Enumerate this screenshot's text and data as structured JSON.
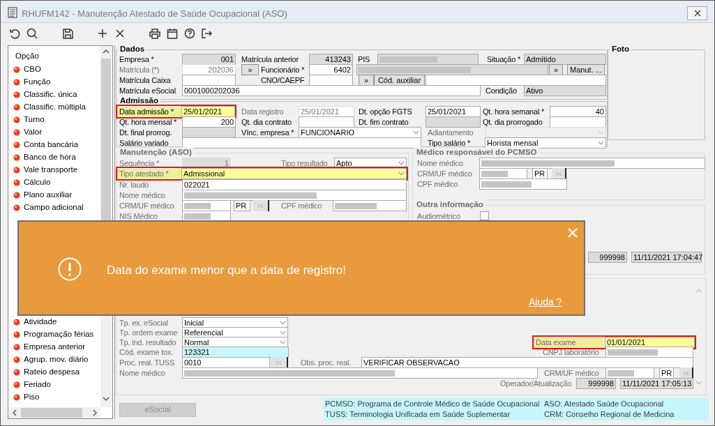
{
  "window": {
    "title": "RHUFM142 - Manutenção Atestado de Saúde Ocupacional (ASO)"
  },
  "sidebar": {
    "header": "Opção",
    "items": [
      {
        "label": "CBO"
      },
      {
        "label": "Função"
      },
      {
        "label": "Classific. única"
      },
      {
        "label": "Classific. múltipla"
      },
      {
        "label": "Turno"
      },
      {
        "label": "Valor"
      },
      {
        "label": "Conta bancária"
      },
      {
        "label": "Banco de hora"
      },
      {
        "label": "Vale transporte"
      },
      {
        "label": "Cálculo"
      },
      {
        "label": "Plano auxiliar"
      },
      {
        "label": "Campo adicional"
      }
    ],
    "items_below": [
      {
        "label": "Atividade"
      },
      {
        "label": "Programação férias"
      },
      {
        "label": "Empresa anterior"
      },
      {
        "label": "Agrup. mov. diário"
      },
      {
        "label": "Rateio despesa"
      },
      {
        "label": "Feriado"
      },
      {
        "label": "Piso"
      }
    ]
  },
  "sections": [
    {
      "title": "Dados",
      "disabled": false,
      "rows": [
        {
          "items": [
            {
              "kind": "label",
              "text": "Empresa *",
              "disabled": false
            },
            {
              "kind": "readonly",
              "value": "001",
              "masked": false,
              "disabled": false
            },
            {
              "kind": "label",
              "text": "Matrícula anterior",
              "disabled": false
            },
            {
              "kind": "readonly",
              "value": "413243",
              "masked": false,
              "disabled": false
            },
            {
              "kind": "label",
              "text": "PIS",
              "disabled": false
            },
            {
              "kind": "readonly",
              "masked": true,
              "disabled": false
            },
            {
              "kind": "label",
              "text": "Situação *",
              "disabled": false
            },
            {
              "kind": "readonly",
              "value": "Admitido",
              "masked": false,
              "disabled": false
            }
          ]
        },
        {
          "items": [
            {
              "kind": "label",
              "text": "Matrícula (*)",
              "disabled": true
            },
            {
              "kind": "field",
              "value": "202036",
              "masked": false,
              "disabled": true
            },
            {
              "kind": "button",
              "text": "»"
            },
            {
              "kind": "label",
              "text": "Funcionário *",
              "disabled": false
            },
            {
              "kind": "field",
              "value": "6402",
              "masked": false,
              "disabled": false
            },
            {
              "kind": "readonly",
              "masked": true,
              "disabled": false
            },
            {
              "kind": "button",
              "text": "»"
            },
            {
              "kind": "button",
              "text": "Manut. ..."
            }
          ]
        },
        {
          "items": [
            {
              "kind": "label",
              "text": "Matrícula Caixa",
              "disabled": false
            },
            {
              "kind": "field",
              "masked": false,
              "disabled": false
            },
            {
              "kind": "label",
              "text": "CNO/CAEPF",
              "disabled": false
            },
            {
              "kind": "field",
              "masked": false,
              "disabled": false
            },
            {
              "kind": "button",
              "text": "»"
            },
            {
              "kind": "button",
              "text": "Cód. auxiliar"
            },
            {
              "kind": "field",
              "masked": false,
              "disabled": false
            }
          ]
        },
        {
          "items": [
            {
              "kind": "label",
              "text": "Matrícula eSocial",
              "disabled": false
            },
            {
              "kind": "field",
              "value": "0001000202036",
              "masked": false,
              "disabled": false
            },
            {
              "kind": "label",
              "text": "Condição",
              "disabled": false
            },
            {
              "kind": "readonly",
              "value": "Ativo",
              "masked": false,
              "disabled": false
            }
          ]
        }
      ]
    },
    {
      "title": "Foto",
      "disabled": false
    },
    {
      "title": "Admissão",
      "disabled": false,
      "rows": [
        {
          "items": [
            {
              "kind": "alert",
              "items": [
                {
                  "kind": "label",
                  "text": "Data admissão *",
                  "disabled": false
                },
                {
                  "kind": "field",
                  "value": "25/01/2021",
                  "masked": false,
                  "disabled": false
                }
              ]
            },
            {
              "kind": "label",
              "text": "Data registro",
              "disabled": true
            },
            {
              "kind": "field",
              "value": "25/01/2021",
              "masked": false,
              "disabled": true
            },
            {
              "kind": "label",
              "text": "Dt. opção FGTS",
              "disabled": false
            },
            {
              "kind": "field",
              "value": "25/01/2021",
              "masked": false,
              "disabled": false
            },
            {
              "kind": "label",
              "text": "Qt. hora semanal *",
              "disabled": false
            },
            {
              "kind": "field",
              "value": "40",
              "masked": false,
              "disabled": false
            }
          ]
        },
        {
          "items": [
            {
              "kind": "label",
              "text": "Qt. hora mensal *",
              "disabled": false
            },
            {
              "kind": "field",
              "value": "200",
              "masked": false,
              "disabled": false
            },
            {
              "kind": "label",
              "text": "Qt. dia contrato",
              "disabled": false
            },
            {
              "kind": "field",
              "masked": false,
              "disabled": false
            },
            {
              "kind": "label",
              "text": "Dt. fim contrato",
              "disabled": false
            },
            {
              "kind": "readonly",
              "masked": false,
              "disabled": false
            },
            {
              "kind": "label",
              "text": "Qt. dia prorrogado",
              "disabled": false
            },
            {
              "kind": "field",
              "masked": false,
              "disabled": false
            }
          ]
        },
        {
          "items": [
            {
              "kind": "label",
              "text": "Dt. final prorrog.",
              "disabled": false
            },
            {
              "kind": "readonly",
              "masked": false,
              "disabled": false
            },
            {
              "kind": "label",
              "text": "Vínc. empresa *",
              "disabled": false
            },
            {
              "kind": "select",
              "value": "FUNCIONARIO",
              "masked": false,
              "disabled": false
            },
            {
              "kind": "label",
              "text": "Adiantamento",
              "disabled": true
            },
            {
              "kind": "select",
              "masked": false,
              "disabled": true
            }
          ]
        },
        {
          "items": [
            {
              "kind": "label",
              "text": "Salário variado",
              "disabled": false
            },
            {
              "kind": "field",
              "masked": false,
              "disabled": false
            },
            {
              "kind": "label",
              "text": "Tipo salário *",
              "disabled": false
            },
            {
              "kind": "select",
              "value": "Horista mensal",
              "masked": false,
              "disabled": false
            }
          ]
        }
      ]
    },
    {
      "title": "Manutenção (ASO)",
      "disabled": true,
      "rows": [
        {
          "items": [
            {
              "kind": "label",
              "text": "Sequência *",
              "disabled": true
            },
            {
              "kind": "readonly",
              "value": "1",
              "masked": false,
              "disabled": true
            },
            {
              "kind": "label",
              "text": "Tipo resultado",
              "disabled": true
            },
            {
              "kind": "select",
              "value": "Apto",
              "masked": false,
              "disabled": false
            }
          ]
        },
        {
          "items": [
            {
              "kind": "alert",
              "items": [
                {
                  "kind": "label",
                  "text": "Tipo atestado *",
                  "disabled": true
                },
                {
                  "kind": "select",
                  "value": "Admissional",
                  "masked": false,
                  "disabled": false
                }
              ]
            }
          ]
        },
        {
          "items": [
            {
              "kind": "label",
              "text": "Nr. laudo",
              "disabled": true
            },
            {
              "kind": "field",
              "value": "022021",
              "masked": false,
              "disabled": false
            }
          ]
        },
        {
          "items": [
            {
              "kind": "label",
              "text": "Nome médico",
              "disabled": true
            },
            {
              "kind": "field",
              "masked": true,
              "disabled": false
            }
          ]
        },
        {
          "items": [
            {
              "kind": "label",
              "text": "CRM/UF médico",
              "disabled": true
            },
            {
              "kind": "field",
              "masked": true,
              "disabled": false
            },
            {
              "kind": "field",
              "value": "PR",
              "masked": false,
              "disabled": false
            },
            {
              "kind": "iconbutton"
            },
            {
              "kind": "label",
              "text": "CPF médico",
              "disabled": true
            },
            {
              "kind": "field",
              "masked": true,
              "disabled": false
            }
          ]
        },
        {
          "items": [
            {
              "kind": "label",
              "text": "NIS Médico",
              "disabled": true
            },
            {
              "kind": "field",
              "masked": true,
              "disabled": false
            }
          ]
        }
      ]
    },
    {
      "title": "Médico responsável do PCMSO",
      "disabled": true,
      "rows": [
        {
          "items": [
            {
              "kind": "label",
              "text": "Nome médico",
              "disabled": true
            },
            {
              "kind": "field",
              "masked": true,
              "disabled": false
            }
          ]
        },
        {
          "items": [
            {
              "kind": "label",
              "text": "CRM/UF médico",
              "disabled": true
            },
            {
              "kind": "field",
              "masked": true,
              "disabled": false
            },
            {
              "kind": "field",
              "value": "PR",
              "masked": false,
              "disabled": false
            },
            {
              "kind": "iconbutton"
            }
          ]
        },
        {
          "items": [
            {
              "kind": "label",
              "text": "CPF médico",
              "disabled": true
            },
            {
              "kind": "field",
              "masked": true,
              "disabled": false
            }
          ]
        }
      ]
    },
    {
      "title": "Outra informação",
      "disabled": true,
      "rows": [
        {
          "items": [
            {
              "kind": "label",
              "text": "Audiométrico",
              "disabled": true
            },
            {
              "kind": "check",
              "checked": false
            }
          ]
        },
        {
          "items": [
            {
              "kind": "readonly",
              "value": "999998",
              "masked": false,
              "disabled": false
            },
            {
              "kind": "readonly",
              "value": "11/11/2021 17:04:47",
              "masked": false,
              "disabled": false
            }
          ]
        }
      ]
    },
    {
      "disabled": true,
      "rows": [
        {
          "items": [
            {
              "kind": "label",
              "text": "Tp. ex. eSocial",
              "disabled": true
            },
            {
              "kind": "select",
              "value": "Inicial",
              "masked": false,
              "disabled": false
            }
          ]
        },
        {
          "items": [
            {
              "kind": "label",
              "text": "Tp. ordem exame",
              "disabled": true
            },
            {
              "kind": "select",
              "value": "Referencial",
              "masked": false,
              "disabled": false
            }
          ]
        },
        {
          "items": [
            {
              "kind": "label",
              "text": "Tp. ind. resultado",
              "disabled": true
            },
            {
              "kind": "select",
              "value": "Normal",
              "masked": false,
              "disabled": false
            },
            {
              "kind": "alert",
              "items": [
                {
                  "kind": "label",
                  "text": "Data exame",
                  "disabled": true
                },
                {
                  "kind": "field",
                  "value": "01/01/2021",
                  "masked": false,
                  "disabled": false
                }
              ]
            }
          ]
        },
        {
          "items": [
            {
              "kind": "label",
              "text": "Cód. exame tox.",
              "disabled": true
            },
            {
              "kind": "active",
              "value": "123321",
              "masked": false,
              "disabled": false
            },
            {
              "kind": "label",
              "text": "CNPJ laboratório",
              "disabled": true
            },
            {
              "kind": "field",
              "masked": true,
              "disabled": false
            }
          ]
        },
        {
          "items": [
            {
              "kind": "label",
              "text": "Proc. real. TUSS",
              "disabled": true
            },
            {
              "kind": "field",
              "value": "0010",
              "masked": false,
              "disabled": false
            },
            {
              "kind": "iconbutton"
            },
            {
              "kind": "label",
              "text": "Obs. proc. real.",
              "disabled": true
            },
            {
              "kind": "field",
              "value": "VERIFICAR OBSERVACAO",
              "masked": false,
              "disabled": false
            }
          ]
        },
        {
          "items": [
            {
              "kind": "label",
              "text": "Nome médico",
              "disabled": true
            },
            {
              "kind": "field",
              "masked": true,
              "disabled": false
            },
            {
              "kind": "label",
              "text": "CRM/UF médico",
              "disabled": true
            },
            {
              "kind": "field",
              "masked": true,
              "disabled": false
            },
            {
              "kind": "field",
              "value": "PR",
              "masked": false,
              "disabled": false
            },
            {
              "kind": "iconbutton"
            }
          ]
        },
        {
          "items": [
            {
              "kind": "label",
              "text": "Operador/Atualização",
              "disabled": true
            },
            {
              "kind": "readonly",
              "value": "999998",
              "masked": false,
              "disabled": false
            },
            {
              "kind": "readonly",
              "value": "11/11/2021 17:05:13",
              "masked": false,
              "disabled": false
            }
          ]
        }
      ]
    }
  ],
  "esocial_button": {
    "text": "eSocial",
    "disabled": true
  },
  "legend": [
    "PCMSO: Programa de Controle Médico de Saúde Ocupacional",
    "ASO: Atestado Saúde Ocupacional",
    "TUSS: Terminologia Unificada em Saúde Suplementar",
    "CRM: Conselho Regional de Medicina"
  ],
  "toast": {
    "message": "Data do exame menor que a data de registro!",
    "help_link": "Ajuda ?"
  }
}
